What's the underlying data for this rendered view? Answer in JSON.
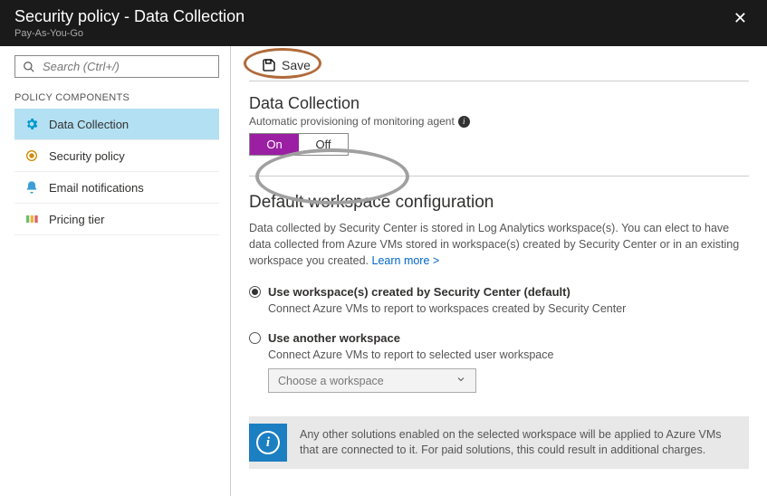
{
  "header": {
    "title": "Security policy - Data Collection",
    "subtitle": "Pay-As-You-Go"
  },
  "search": {
    "placeholder": "Search (Ctrl+/)"
  },
  "sidebar": {
    "section_label": "POLICY COMPONENTS",
    "items": [
      {
        "label": "Data Collection"
      },
      {
        "label": "Security policy"
      },
      {
        "label": "Email notifications"
      },
      {
        "label": "Pricing tier"
      }
    ]
  },
  "toolbar": {
    "save_label": "Save"
  },
  "data_collection": {
    "title": "Data Collection",
    "desc": "Automatic provisioning of monitoring agent",
    "on_label": "On",
    "off_label": "Off"
  },
  "workspace": {
    "title": "Default workspace configuration",
    "desc": "Data collected by Security Center is stored in Log Analytics workspace(s). You can elect to have data collected from Azure VMs stored in workspace(s) created by Security Center or in an existing workspace you created. ",
    "learn_more": "Learn more >",
    "radio1_label": "Use workspace(s) created by Security Center (default)",
    "radio1_sub": "Connect Azure VMs to report to workspaces created by Security Center",
    "radio2_label": "Use another workspace",
    "radio2_sub": "Connect Azure VMs to report to selected user workspace",
    "dropdown_placeholder": "Choose a workspace"
  },
  "banner": {
    "text": "Any other solutions enabled on the selected workspace will be applied to Azure VMs that are connected to it. For paid solutions, this could result in additional charges."
  }
}
